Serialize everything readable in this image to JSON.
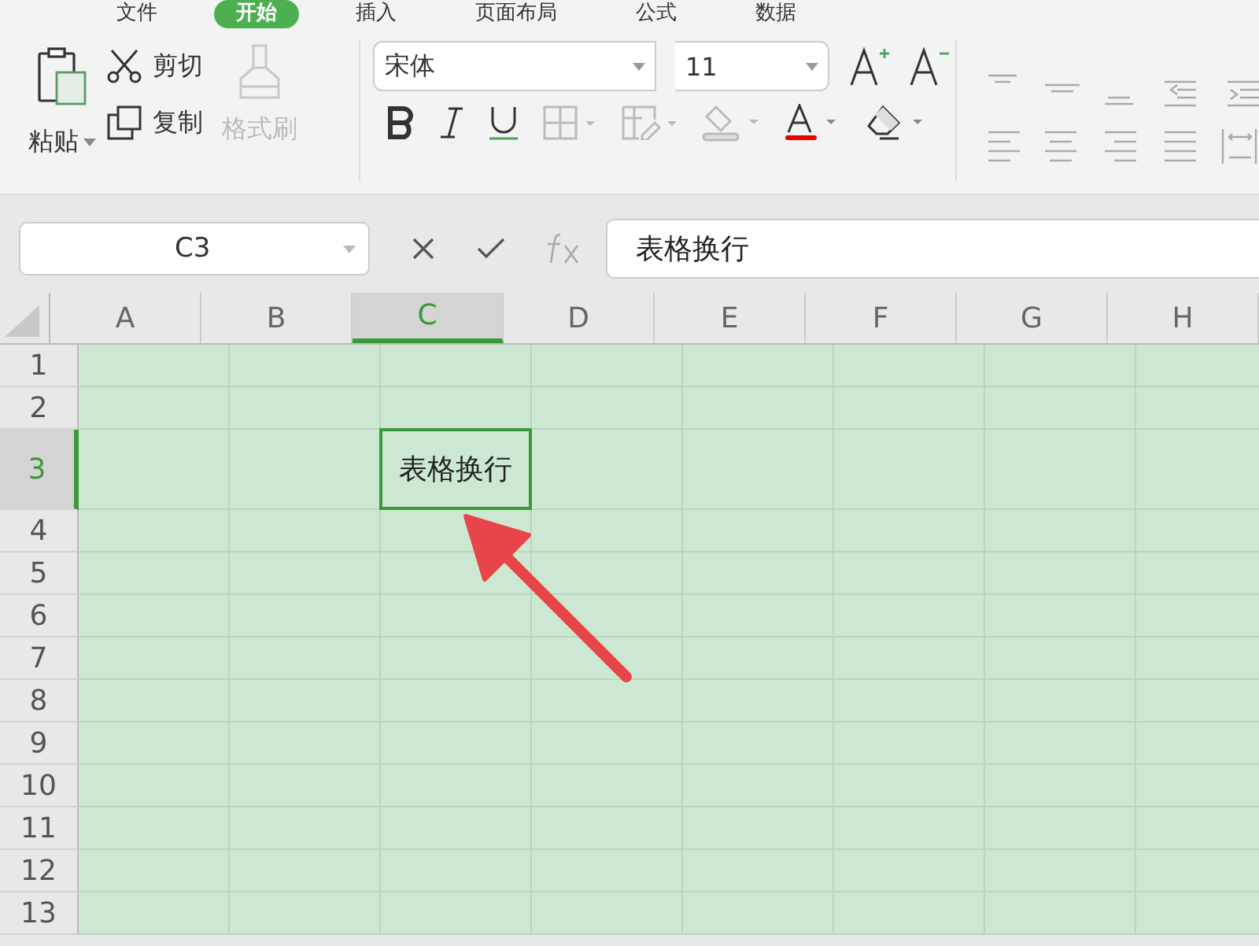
{
  "menu_tabs": [
    {
      "label": "文件",
      "selected": false
    },
    {
      "label": "开始",
      "selected": true
    },
    {
      "label": "插入",
      "selected": false
    },
    {
      "label": "页面布局",
      "selected": false
    },
    {
      "label": "公式",
      "selected": false
    },
    {
      "label": "数据",
      "selected": false
    }
  ],
  "clipboard": {
    "paste": "粘贴",
    "cut": "剪切",
    "copy": "复制",
    "format_painter": {
      "label": "格式刷",
      "disabled": true
    }
  },
  "font": {
    "name": "宋体",
    "size": "11"
  },
  "name_box": "C3",
  "formula": "表格换行",
  "columns": [
    {
      "label": "A",
      "selected": false
    },
    {
      "label": "B",
      "selected": false
    },
    {
      "label": "C",
      "selected": true
    },
    {
      "label": "D",
      "selected": false
    },
    {
      "label": "E",
      "selected": false
    },
    {
      "label": "F",
      "selected": false
    },
    {
      "label": "G",
      "selected": false
    },
    {
      "label": "H",
      "selected": false
    }
  ],
  "rows": [
    {
      "label": "1",
      "selected": false
    },
    {
      "label": "2",
      "selected": false
    },
    {
      "label": "3",
      "selected": true
    },
    {
      "label": "4",
      "selected": false
    },
    {
      "label": "5",
      "selected": false
    },
    {
      "label": "6",
      "selected": false
    },
    {
      "label": "7",
      "selected": false
    },
    {
      "label": "8",
      "selected": false
    },
    {
      "label": "9",
      "selected": false
    },
    {
      "label": "10",
      "selected": false
    },
    {
      "label": "11",
      "selected": false
    },
    {
      "label": "12",
      "selected": false
    },
    {
      "label": "13",
      "selected": false
    }
  ],
  "active_cell": {
    "text": "表格换行"
  }
}
